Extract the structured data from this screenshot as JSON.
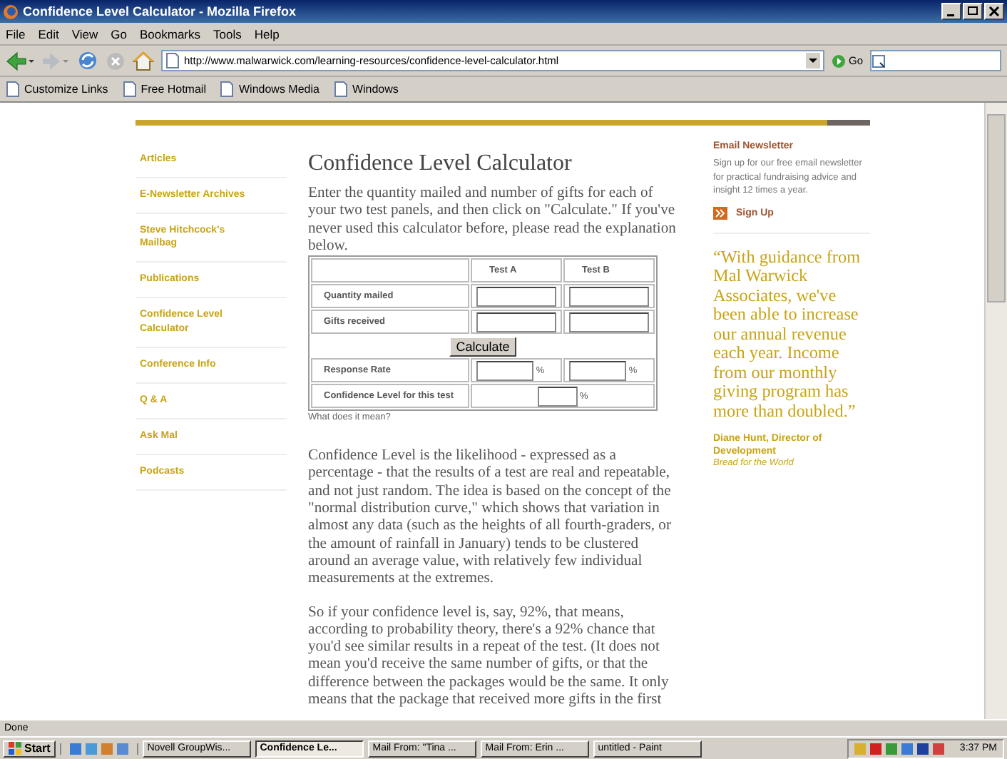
{
  "window": {
    "title": "Confidence Level Calculator - Mozilla Firefox"
  },
  "menu": [
    "File",
    "Edit",
    "View",
    "Go",
    "Bookmarks",
    "Tools",
    "Help"
  ],
  "address": {
    "value": "http://www.malwarwick.com/learning-resources/confidence-level-calculator.html"
  },
  "go_button": "Go",
  "bookmarks": [
    "Customize Links",
    "Free Hotmail",
    "Windows Media",
    "Windows"
  ],
  "sidebar": {
    "items": [
      {
        "label": "Articles"
      },
      {
        "label": "E-Newsletter Archives"
      },
      {
        "label": "Steve Hitchcock's Mailbag"
      },
      {
        "label": "Publications"
      },
      {
        "label": "Confidence Level Calculator"
      },
      {
        "label": "Conference Info"
      },
      {
        "label": "Q & A"
      },
      {
        "label": "Ask Mal"
      },
      {
        "label": "Podcasts"
      }
    ]
  },
  "page": {
    "title": "Confidence Level Calculator",
    "intro": "Enter the quantity mailed and number of gifts for each of your two test panels, and then click on \"Calculate.\" If you've never used this calculator before, please read the explanation below.",
    "calculator": {
      "columns": [
        "Test A",
        "Test B"
      ],
      "rows": [
        {
          "kind": "inputs",
          "label": "Quantity mailed"
        },
        {
          "kind": "inputs",
          "label": "Gifts received"
        },
        {
          "kind": "button",
          "label": "Calculate"
        },
        {
          "kind": "percent",
          "label": "Response Rate",
          "unit_a": "%",
          "unit_b": "%"
        },
        {
          "kind": "single",
          "label": "Confidence Level for this test",
          "unit": "%"
        }
      ]
    },
    "help_link": "What does it mean?",
    "paragraphs": [
      "Confidence Level is the likelihood - expressed as a percentage - that the results of a test are real and repeatable, and not just random. The idea is based on the concept of the \"normal distribution curve,\" which shows that variation in almost any data (such as the heights of all fourth-graders, or the amount of rainfall in January) tends to be clustered around an average value, with relatively few individual measurements at the extremes.",
      "So if your confidence level is, say, 92%, that means, according to probability theory, there's a 92% chance that you'd see similar results in a repeat of the test. (It does not mean you'd receive the same number of gifts, or that the difference between the packages would be the same. It only means that the package that received more gifts in the first"
    ]
  },
  "newsletter": {
    "title": "Email Newsletter",
    "text": "Sign up for our free email newsletter for practical fundraising advice and insight 12 times a year.",
    "link": "Sign Up"
  },
  "quote": {
    "text": "“With guidance from Mal Warwick Associates, we've been able to increase our annual revenue each year. Income from our monthly giving program has more than doubled.”",
    "author": "Diane Hunt, Director of Development",
    "org": "Bread for the World"
  },
  "status_bar": "Done",
  "taskbar": {
    "start": "Start",
    "tasks": [
      {
        "label": "Novell GroupWis...",
        "selected": false
      },
      {
        "label": "Confidence Le...",
        "selected": true
      },
      {
        "label": "Mail From: \"Tina ...",
        "selected": false
      },
      {
        "label": "Mail From: Erin ...",
        "selected": false
      },
      {
        "label": "untitled - Paint",
        "selected": false
      }
    ],
    "clock": "3:37 PM"
  }
}
